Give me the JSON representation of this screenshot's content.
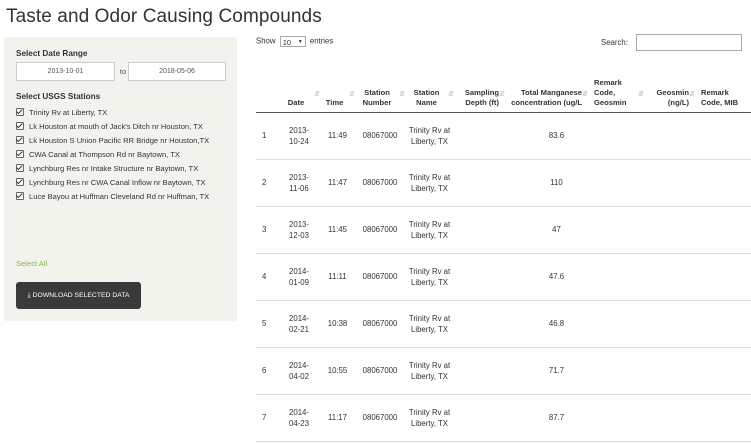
{
  "page_title": "Taste and Odor Causing Compounds",
  "sidebar": {
    "date_range_label": "Select Date Range",
    "start_date": "2013-10-01",
    "date_separator": "to",
    "end_date": "2018-05-06",
    "stations_label": "Select USGS Stations",
    "stations": [
      {
        "label": "Trinity Rv at Liberty, TX",
        "checked": true
      },
      {
        "label": "Lk Houston at mouth of Jack's Ditch nr Houston, TX",
        "checked": true
      },
      {
        "label": "Lk Houston S Union Pacific RR Bridge nr Houston,TX",
        "checked": true
      },
      {
        "label": "CWA Canal at Thompson Rd nr Baytown, TX",
        "checked": true
      },
      {
        "label": "Lynchburg Res nr Intake Structure nr Baytown, TX",
        "checked": true
      },
      {
        "label": "Lynchburg Res nr CWA Canal Inflow nr Baytown, TX",
        "checked": true
      },
      {
        "label": "Luce Bayou at Huffman Cleveland Rd nr Huffman, TX",
        "checked": true
      }
    ],
    "select_all": "Select All",
    "download_label": "DOWNLOAD SELECTED DATA",
    "download_icon": "download-icon"
  },
  "table_controls": {
    "show_label": "Show",
    "page_length": "10",
    "entries_label": "entries",
    "search_label": "Search:",
    "search_value": ""
  },
  "table": {
    "columns": [
      "",
      "Date",
      "Time",
      "Station Number",
      "Station Name",
      "Sampling Depth (ft)",
      "Total Manganese concentration (ug/L",
      "Remark Code, Geosmin",
      "Geosmin (ng/L)",
      "Remark Code, MIB"
    ],
    "rows": [
      {
        "idx": "1",
        "date": "2013-10-24",
        "time": "11:49",
        "station_number": "08067000",
        "station_name": "Trinity Rv at Liberty, TX",
        "depth": "",
        "manganese": "83.6",
        "remark_geosmin": "",
        "geosmin": "",
        "remark_mib": ""
      },
      {
        "idx": "2",
        "date": "2013-11-06",
        "time": "11:47",
        "station_number": "08067000",
        "station_name": "Trinity Rv at Liberty, TX",
        "depth": "",
        "manganese": "110",
        "remark_geosmin": "",
        "geosmin": "",
        "remark_mib": ""
      },
      {
        "idx": "3",
        "date": "2013-12-03",
        "time": "11:45",
        "station_number": "08067000",
        "station_name": "Trinity Rv at Liberty, TX",
        "depth": "",
        "manganese": "47",
        "remark_geosmin": "",
        "geosmin": "",
        "remark_mib": ""
      },
      {
        "idx": "4",
        "date": "2014-01-09",
        "time": "11:11",
        "station_number": "08067000",
        "station_name": "Trinity Rv at Liberty, TX",
        "depth": "",
        "manganese": "47.6",
        "remark_geosmin": "",
        "geosmin": "",
        "remark_mib": ""
      },
      {
        "idx": "5",
        "date": "2014-02-21",
        "time": "10:38",
        "station_number": "08067000",
        "station_name": "Trinity Rv at Liberty, TX",
        "depth": "",
        "manganese": "46.8",
        "remark_geosmin": "",
        "geosmin": "",
        "remark_mib": ""
      },
      {
        "idx": "6",
        "date": "2014-04-02",
        "time": "10:55",
        "station_number": "08067000",
        "station_name": "Trinity Rv at Liberty, TX",
        "depth": "",
        "manganese": "71.7",
        "remark_geosmin": "",
        "geosmin": "",
        "remark_mib": ""
      },
      {
        "idx": "7",
        "date": "2014-04-23",
        "time": "11:17",
        "station_number": "08067000",
        "station_name": "Trinity Rv at Liberty, TX",
        "depth": "",
        "manganese": "87.7",
        "remark_geosmin": "",
        "geosmin": "",
        "remark_mib": ""
      }
    ]
  },
  "colors": {
    "sidebar_bg": "#f3f3ee",
    "select_all": "#88b05a",
    "button_bg": "#3a3a3a"
  }
}
